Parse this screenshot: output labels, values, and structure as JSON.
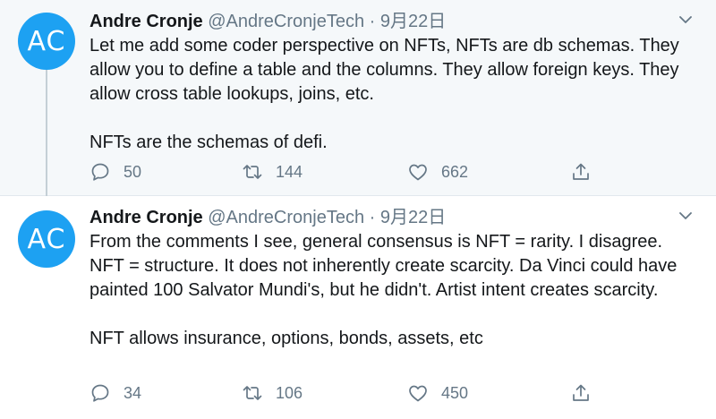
{
  "tweets": [
    {
      "avatar_text": "AC",
      "name": "Andre Cronje",
      "handle": "@AndreCronjeTech",
      "separator": "·",
      "date": "9月22日",
      "paragraphs": [
        "Let me add some coder perspective on NFTs, NFTs are db schemas. They allow you to define a table and the columns. They allow foreign keys. They allow cross table lookups, joins, etc.",
        "NFTs are the schemas of defi."
      ],
      "replies": "50",
      "retweets": "144",
      "likes": "662",
      "background": "#f5f8fa"
    },
    {
      "avatar_text": "AC",
      "name": "Andre Cronje",
      "handle": "@AndreCronjeTech",
      "separator": "·",
      "date": "9月22日",
      "paragraphs": [
        "From the comments I see, general consensus is NFT = rarity. I disagree. NFT = structure. It does not inherently create scarcity. Da Vinci could have painted 100 Salvator Mundi's, but he didn't. Artist intent creates scarcity.",
        "NFT allows insurance, options, bonds, assets, etc"
      ],
      "replies": "34",
      "retweets": "106",
      "likes": "450",
      "background": "#ffffff"
    }
  ],
  "colors": {
    "avatar": "#1da1f2",
    "text": "#14171a",
    "secondary": "#657786",
    "thread_line": "#c4cfd6"
  },
  "icons": [
    "chevron-down-icon",
    "reply-icon",
    "retweet-icon",
    "like-icon",
    "share-icon"
  ]
}
